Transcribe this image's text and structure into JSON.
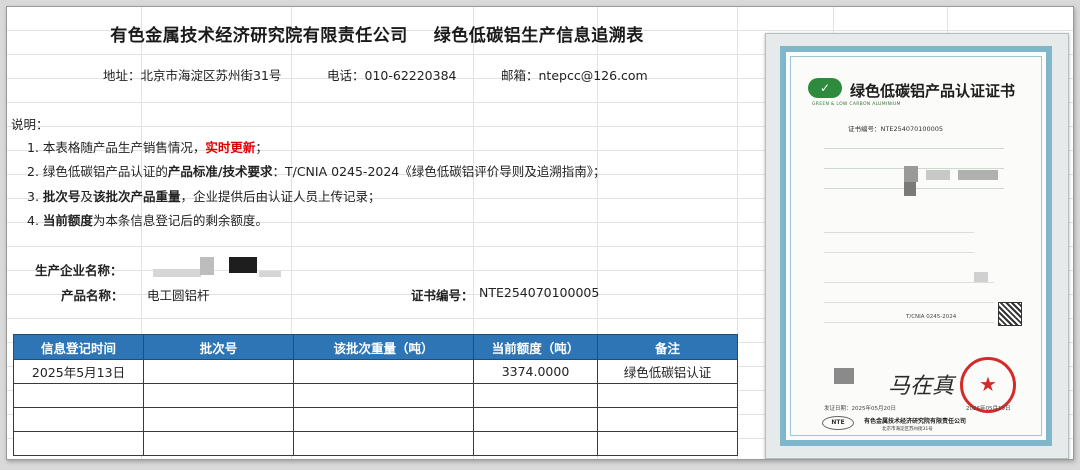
{
  "title": {
    "company": "有色金属技术经济研究院有限责任公司",
    "form": "绿色低碳铝生产信息追溯表"
  },
  "contact": {
    "address": "地址：北京市海淀区苏州街31号",
    "phone": "电话：010-62220384",
    "email": "邮箱：ntepcc@126.com"
  },
  "notes": {
    "heading": "说明：",
    "n1_text": "1. 本表格随产品生产销售情况，",
    "n1_red": "实时更新",
    "n1_end": "；",
    "n2_pre": "2. 绿色低碳铝产品认证的",
    "n2_bold": "产品标准/技术要求",
    "n2_text": "：T/CNIA 0245-2024《绿色低碳铝评价导则及追溯指南》；",
    "n3_num": "3. ",
    "n3_bold1": "批次号",
    "n3_mid": "及",
    "n3_bold2": "该批次产品重量",
    "n3_text": "，企业提供后由认证人员上传记录；",
    "n4_num": "4. ",
    "n4_bold": "当前额度",
    "n4_text": "为本条信息登记后的剩余额度。"
  },
  "info": {
    "producer_label": "生产企业名称：",
    "product_label": "产品名称：",
    "product_value": "电工圆铝杆",
    "cert_label": "证书编号：",
    "cert_value": "NTE254070100005"
  },
  "table": {
    "headers": [
      "信息登记时间",
      "批次号",
      "该批次重量（吨）",
      "当前额度（吨）",
      "备注"
    ],
    "rows": [
      [
        "2025年5月13日",
        "",
        "",
        "3374.0000",
        "绿色低碳铝认证"
      ],
      [
        "",
        "",
        "",
        "",
        ""
      ],
      [
        "",
        "",
        "",
        "",
        ""
      ],
      [
        "",
        "",
        "",
        "",
        ""
      ]
    ]
  },
  "certificate": {
    "title": "绿色低碳铝产品认证证书",
    "subtitle": "GREEN & LOW CARBON ALUMINIUM",
    "cert_no": "证书编号：NTE254070100005",
    "standard": "T/CNIA 0245-2024",
    "dates": "发证日期：2025年05月20日",
    "expiry": "2026年05月19日",
    "logo_text": "NTE",
    "issuer": "有色金属技术经济研究院有限责任公司",
    "issuer_address": "北京市海淀区苏州街31号"
  },
  "colors": {
    "header_blue": "#2e75b6",
    "red_highlight": "#e00000",
    "seal_red": "#d32a2a"
  }
}
